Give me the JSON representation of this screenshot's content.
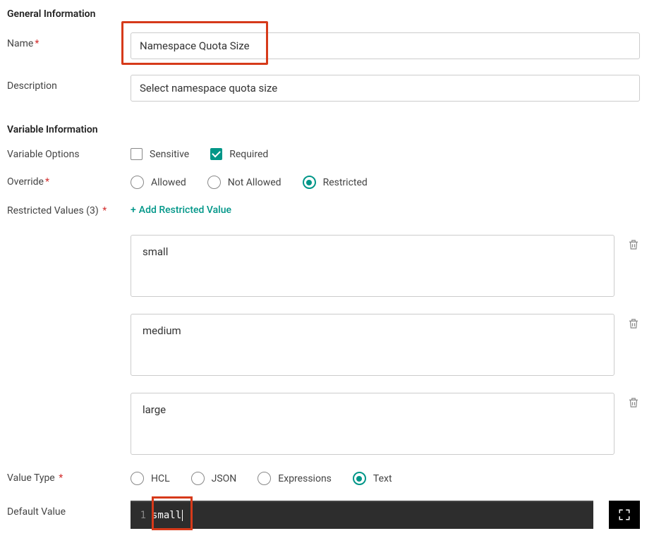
{
  "sections": {
    "general": "General Information",
    "variable": "Variable Information"
  },
  "labels": {
    "name": "Name",
    "description": "Description",
    "variable_options": "Variable Options",
    "override": "Override",
    "restricted_values_prefix": "Restricted Values (",
    "restricted_values_count": "3",
    "restricted_values_suffix": ")",
    "value_type": "Value Type",
    "default_value": "Default Value"
  },
  "fields": {
    "name_value": "Namespace Quota Size",
    "description_value": "Select namespace quota size"
  },
  "options": {
    "sensitive": "Sensitive",
    "required": "Required"
  },
  "override": {
    "allowed": "Allowed",
    "not_allowed": "Not Allowed",
    "restricted": "Restricted"
  },
  "add_restricted_label": "Add Restricted Value",
  "restricted_values": [
    "small",
    "medium",
    "large"
  ],
  "value_types": {
    "hcl": "HCL",
    "json": "JSON",
    "expressions": "Expressions",
    "text": "Text"
  },
  "editor": {
    "line_no": "1",
    "content": "small"
  }
}
